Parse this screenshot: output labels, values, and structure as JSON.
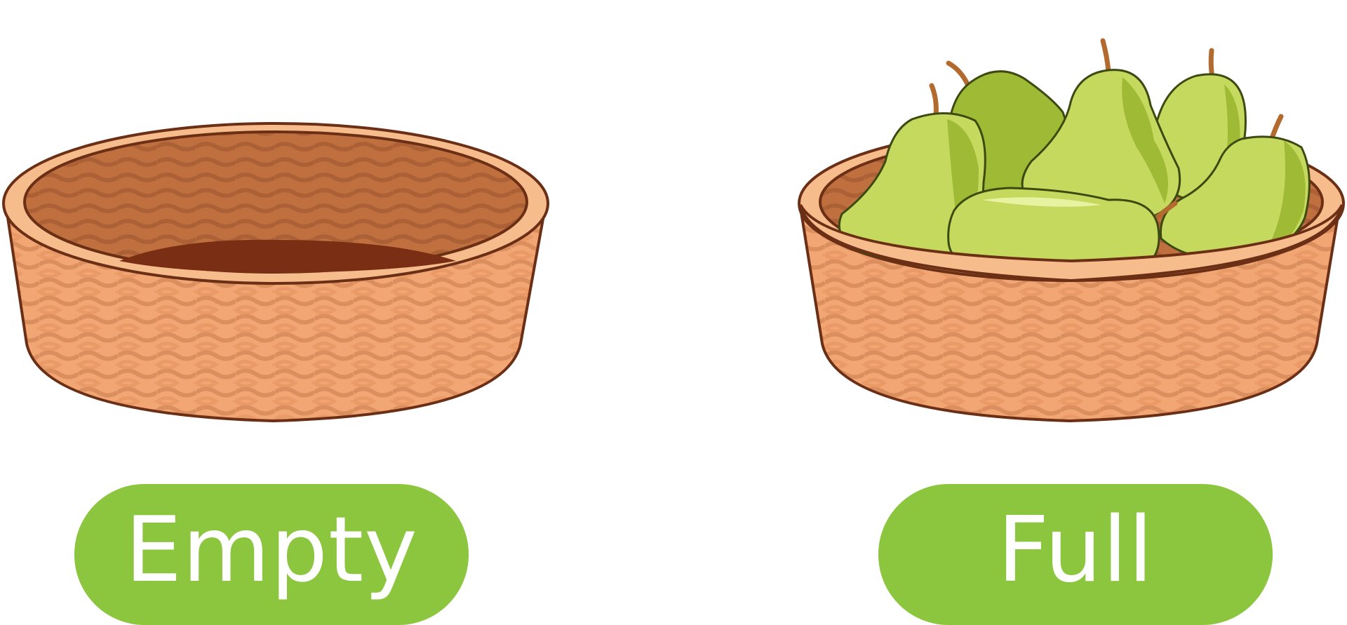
{
  "labels": {
    "empty": "Empty",
    "full": "Full"
  },
  "colors": {
    "pill_green": "#8cc63f",
    "basket_outer": "#f2a673",
    "basket_rim": "#f7bc8c",
    "basket_inner": "#b8663a",
    "basket_outline": "#6b2f16",
    "pear_light": "#c6d95f",
    "pear_dark": "#9fba34",
    "pear_highlight": "#e8f2a0",
    "stem": "#b36a2e"
  },
  "icons": [
    "empty-basket",
    "full-basket-of-pears"
  ]
}
